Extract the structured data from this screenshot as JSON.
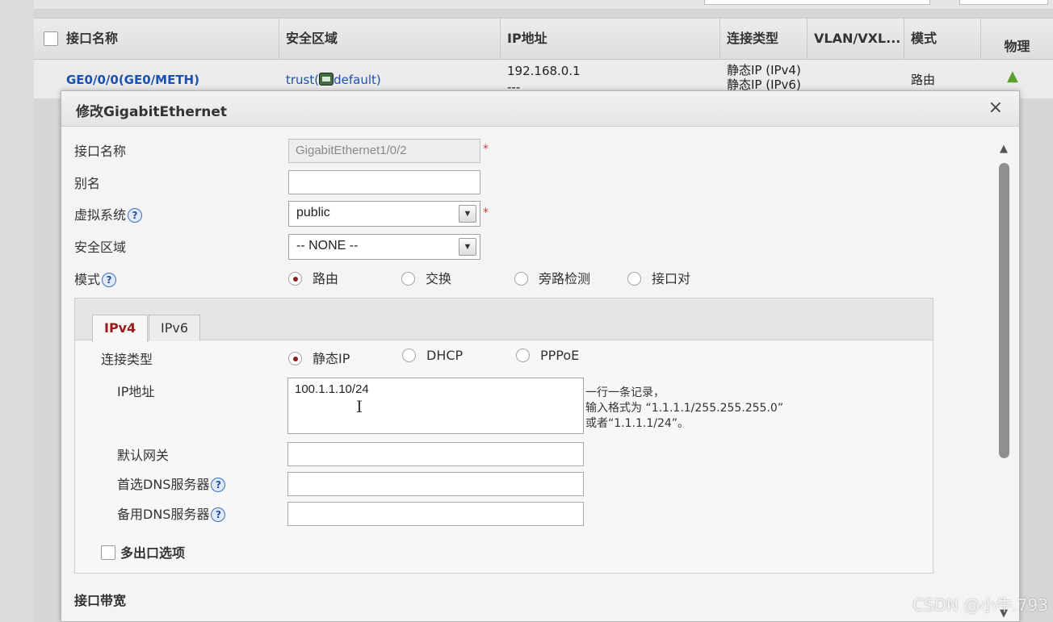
{
  "table": {
    "headers": [
      "接口名称",
      "安全区域",
      "IP地址",
      "连接类型",
      "VLAN/VXL...",
      "模式",
      "物理"
    ],
    "row": {
      "name": "GE0/0/0(GE0/METH)",
      "zone_prefix": "trust(",
      "zone_suffix": "default)",
      "ip_line1": "192.168.0.1",
      "ip_line2": "---",
      "conn_line1": "静态IP (IPv4)",
      "conn_line2": "静态IP (IPv6)",
      "mode": "路由"
    }
  },
  "dialog": {
    "title": "修改GigabitEthernet",
    "close_label": "×",
    "fields": {
      "name_label": "接口名称",
      "name_value": "GigabitEthernet1/0/2",
      "alias_label": "别名",
      "alias_value": "",
      "vsys_label": "虚拟系统",
      "vsys_value": "public",
      "zone_label": "安全区域",
      "zone_value": "-- NONE --",
      "mode_label": "模式"
    },
    "required_mark": "*",
    "help_mark": "?",
    "mode_options": [
      {
        "label": "路由",
        "selected": true
      },
      {
        "label": "交换",
        "selected": false
      },
      {
        "label": "旁路检测",
        "selected": false
      },
      {
        "label": "接口对",
        "selected": false
      }
    ],
    "tabs": [
      "IPv4",
      "IPv6"
    ],
    "active_tab": "IPv4",
    "ipv4": {
      "conn_type_label": "连接类型",
      "conn_options": [
        {
          "label": "静态IP",
          "selected": true
        },
        {
          "label": "DHCP",
          "selected": false
        },
        {
          "label": "PPPoE",
          "selected": false
        }
      ],
      "ip_label": "IP地址",
      "ip_value": "100.1.1.10/24",
      "hint_line1": "一行一条记录，",
      "hint_line2": "输入格式为 “1.1.1.1/255.255.255.0”",
      "hint_line3": "或者“1.1.1.1/24”。",
      "gateway_label": "默认网关",
      "gateway_value": "",
      "dns1_label": "首选DNS服务器",
      "dns1_value": "",
      "dns2_label": "备用DNS服务器",
      "dns2_value": "",
      "multi_exit_label": "多出口选项"
    },
    "bandwidth_label": "接口带宽"
  },
  "watermark": "CSDN @小牛.793",
  "colors": {
    "link": "#1a50b0",
    "active_tab": "#9b1a1a",
    "required": "#d23a3a",
    "radio_selected": "#8b1e1e"
  }
}
